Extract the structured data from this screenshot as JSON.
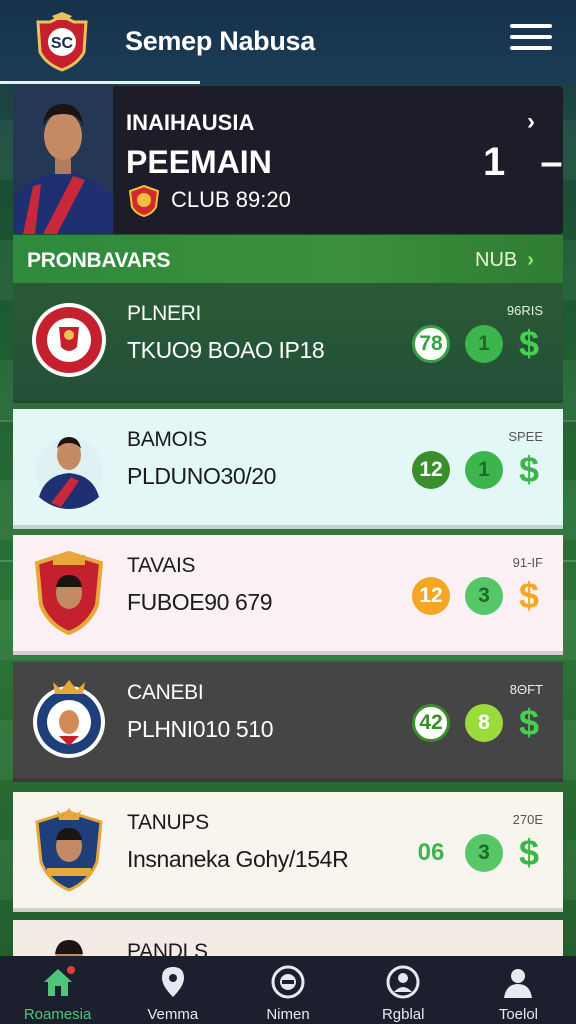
{
  "header": {
    "app_title": "Semep Nabusa",
    "logo_text": "SC"
  },
  "hero": {
    "name_small": "INAIHAUSIA",
    "name_big": "PEEMAIN",
    "club": "CLUB 89:20",
    "score_left": "1",
    "score_right": "–",
    "chevron": "›"
  },
  "section": {
    "title": "PRONBAVARS",
    "link_label": "NUB",
    "link_chevron": "›"
  },
  "rows": [
    {
      "title": "PLNERI",
      "subtitle": "TKUO9 BOAO IP18",
      "meta": "96RIS",
      "badge1": "78",
      "badge2": "1",
      "dollar": "$"
    },
    {
      "title": "BAMOIS",
      "subtitle": "PLDUNO30/20",
      "meta": "SPEE",
      "badge1": "12",
      "badge2": "1",
      "dollar": "$"
    },
    {
      "title": "TAVAIS",
      "subtitle": "FUBOE90 679",
      "meta": "91-IF",
      "badge1": "12",
      "badge2": "3",
      "dollar": "$"
    },
    {
      "title": "CANEBI",
      "subtitle": "PLHNI010 510",
      "meta": "8ΘFT",
      "badge1": "42",
      "badge2": "8",
      "dollar": "$"
    },
    {
      "title": "TANUPS",
      "subtitle": "Insnaneka Gohy/154R",
      "meta": "270E",
      "badge1": "06",
      "badge2": "3",
      "dollar": "$"
    },
    {
      "title": "PANDLS",
      "subtitle": "",
      "meta": ""
    }
  ],
  "nav": [
    {
      "label": "Roamesia",
      "icon": "home-icon"
    },
    {
      "label": "Vemma",
      "icon": "location-pin-icon"
    },
    {
      "label": "Nimen",
      "icon": "circle-menu-icon"
    },
    {
      "label": "Rgblal",
      "icon": "person-target-icon"
    },
    {
      "label": "Toelol",
      "icon": "user-icon"
    }
  ],
  "colors": {
    "accent_green": "#3cb54a",
    "orange": "#f5a623",
    "header_bg": "#1b3c58",
    "nav_bg": "#1b1f2e"
  }
}
